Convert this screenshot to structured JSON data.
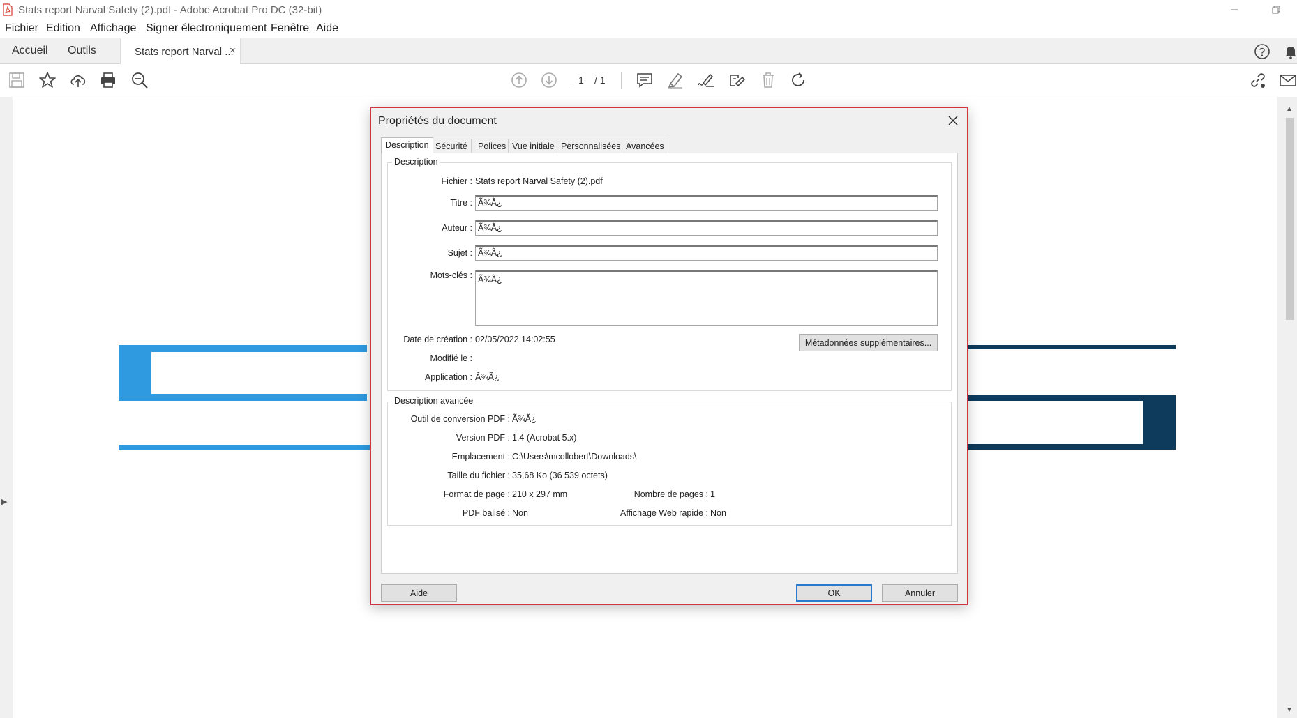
{
  "window": {
    "title": "Stats report Narval Safety (2).pdf - Adobe Acrobat Pro DC (32-bit)"
  },
  "menu": [
    "Fichier",
    "Edition",
    "Affichage",
    "Signer électroniquement",
    "Fenêtre",
    "Aide"
  ],
  "tabs": {
    "home": "Accueil",
    "tools": "Outils",
    "document": "Stats report Narval ...",
    "close": "×"
  },
  "toolbar": {
    "page_current": "1",
    "page_total": "/ 1"
  },
  "dialog": {
    "title": "Propriétés du document",
    "tabs": [
      "Description",
      "Sécurité",
      "Polices",
      "Vue initiale",
      "Personnalisées",
      "Avancées"
    ],
    "description": {
      "legend": "Description",
      "file_label": "Fichier :",
      "file_value": "Stats report Narval Safety (2).pdf",
      "title_label": "Titre :",
      "title_value": "Ã¾Ã¿",
      "author_label": "Auteur :",
      "author_value": "Ã¾Ã¿",
      "subject_label": "Sujet :",
      "subject_value": "Ã¾Ã¿",
      "keywords_label": "Mots-clés :",
      "keywords_value": "Ã¾Ã¿",
      "created_label": "Date de création :",
      "created_value": "02/05/2022 14:02:55",
      "modified_label": "Modifié le :",
      "modified_value": "",
      "application_label": "Application :",
      "application_value": "Ã¾Ã¿",
      "metadata_button": "Métadonnées supplémentaires..."
    },
    "advanced": {
      "legend": "Description avancée",
      "converter_label": "Outil de conversion PDF :",
      "converter_value": "Ã¾Ã¿",
      "version_label": "Version PDF :",
      "version_value": "1.4 (Acrobat 5.x)",
      "location_label": "Emplacement :",
      "location_value": "C:\\Users\\mcollobert\\Downloads\\",
      "size_label": "Taille du fichier :",
      "size_value": "35,68 Ko (36 539 octets)",
      "page_format_label": "Format de page :",
      "page_format_value": "210 x 297 mm",
      "page_count_label": "Nombre de pages :",
      "page_count_value": "1",
      "tagged_label": "PDF balisé :",
      "tagged_value": "Non",
      "fast_web_label": "Affichage Web rapide :",
      "fast_web_value": "Non"
    },
    "buttons": {
      "help": "Aide",
      "ok": "OK",
      "cancel": "Annuler"
    }
  },
  "colors": {
    "accent_blue": "#2f9ae0",
    "dark_blue": "#0e3a5c",
    "dialog_border": "#d0353f",
    "pdf_red": "#d63a2f"
  }
}
